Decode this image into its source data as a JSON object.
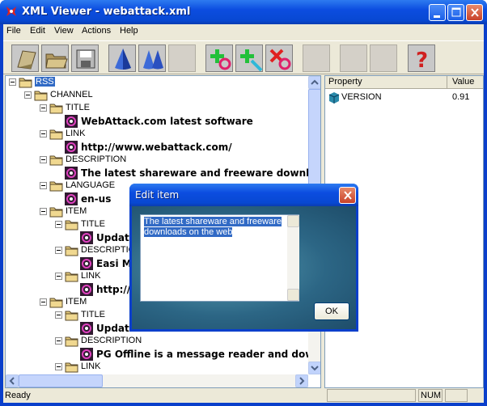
{
  "window": {
    "title": "XML Viewer - webattack.xml"
  },
  "menu": [
    "File",
    "Edit",
    "View",
    "Actions",
    "Help"
  ],
  "toolbar": [
    {
      "icon": "open-file-icon",
      "enabled": true
    },
    {
      "icon": "open-folder-icon",
      "enabled": true
    },
    {
      "icon": "save-disk-icon",
      "enabled": true
    },
    {
      "icon": "cone-single-icon",
      "enabled": true
    },
    {
      "icon": "cones-double-icon",
      "enabled": true
    },
    {
      "icon": "blank",
      "enabled": false
    },
    {
      "icon": "add-child-icon",
      "enabled": true
    },
    {
      "icon": "add-item-icon",
      "enabled": true
    },
    {
      "icon": "remove-item-icon",
      "enabled": true
    },
    {
      "icon": "blank",
      "enabled": false
    },
    {
      "icon": "blank",
      "enabled": false
    },
    {
      "icon": "blank",
      "enabled": false
    },
    {
      "icon": "help-icon",
      "enabled": true
    }
  ],
  "tree": [
    {
      "label": "RSS",
      "type": "element",
      "selected": true
    },
    {
      "label": "CHANNEL",
      "type": "element"
    },
    {
      "label": "TITLE",
      "type": "element"
    },
    {
      "label": "WebAttack.com latest software",
      "type": "value"
    },
    {
      "label": "LINK",
      "type": "element"
    },
    {
      "label": "http://www.webattack.com/",
      "type": "value"
    },
    {
      "label": "DESCRIPTION",
      "type": "element"
    },
    {
      "label": "The latest shareware and freeware downloads on",
      "type": "value"
    },
    {
      "label": "LANGUAGE",
      "type": "element"
    },
    {
      "label": "en-us",
      "type": "value"
    },
    {
      "label": "ITEM",
      "type": "element"
    },
    {
      "label": "TITLE",
      "type": "element"
    },
    {
      "label": "Update",
      "type": "value"
    },
    {
      "label": "DESCRIPTION",
      "type": "element"
    },
    {
      "label": "Easi Mp",
      "type": "value"
    },
    {
      "label": "LINK",
      "type": "element"
    },
    {
      "label": "http://",
      "type": "value"
    },
    {
      "label": "ITEM",
      "type": "element"
    },
    {
      "label": "TITLE",
      "type": "element"
    },
    {
      "label": "Update",
      "type": "value"
    },
    {
      "label": "DESCRIPTION",
      "type": "element"
    },
    {
      "label": "PG Offline is a message reader and downloade",
      "type": "value"
    },
    {
      "label": "LINK",
      "type": "element"
    }
  ],
  "props": {
    "col_property": "Property",
    "col_value": "Value",
    "rows": [
      {
        "property": "VERSION",
        "value": "0.91"
      }
    ]
  },
  "status": {
    "text": "Ready",
    "num": "NUM"
  },
  "dialog": {
    "title": "Edit item",
    "text_line1": "The latest shareware and freeware",
    "text_line2": "downloads on the web",
    "ok": "OK"
  }
}
